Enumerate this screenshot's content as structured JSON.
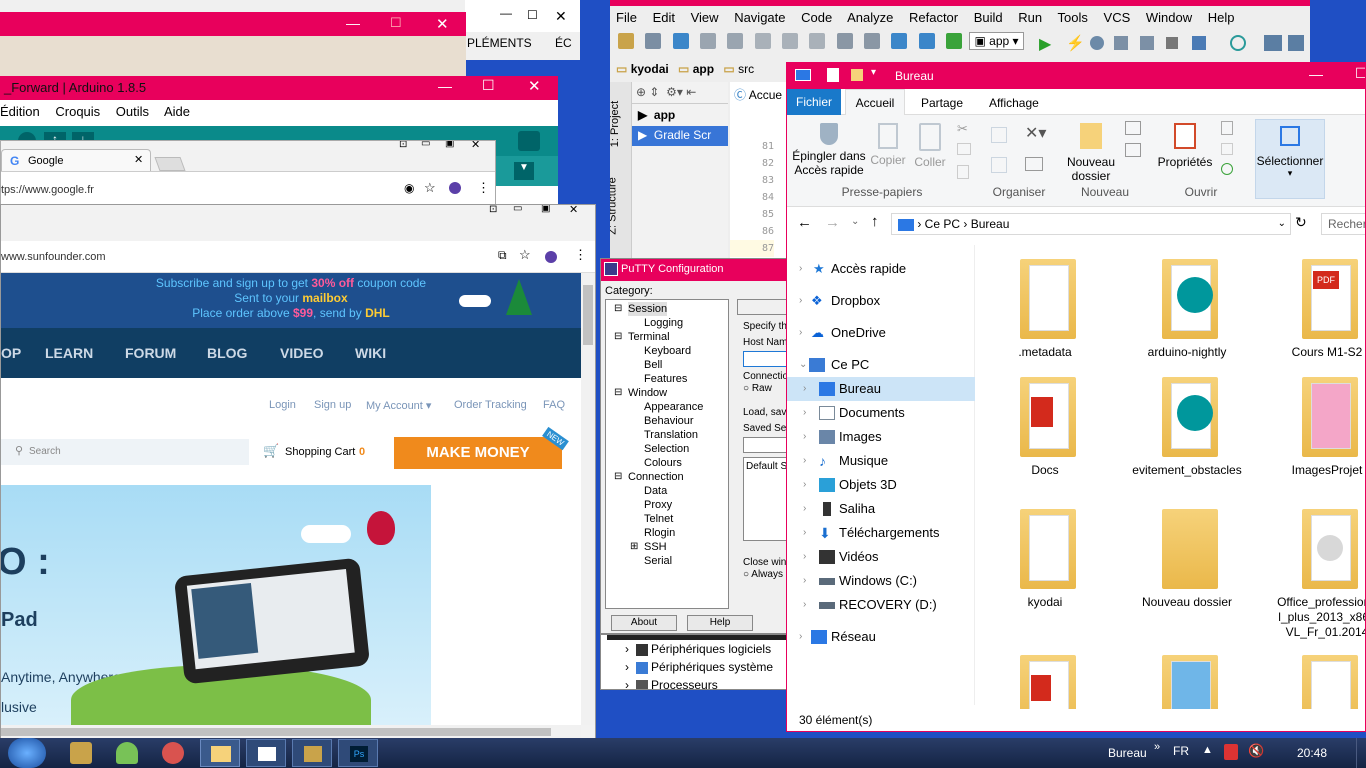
{
  "behind_window": {
    "tab1": "PLÉMENTS",
    "tab2": "ÉC"
  },
  "arduino_top": {},
  "arduino": {
    "title": "_Forward | Arduino 1.8.5",
    "menu": [
      "Édition",
      "Croquis",
      "Outils",
      "Aide"
    ]
  },
  "chrome_google": {
    "tab": "Google",
    "url": "tps://www.google.fr"
  },
  "sunfounder": {
    "url": "www.sunfounder.com",
    "banner_line1_a": "Subscribe and sign up to get ",
    "banner_line1_b": "30% off",
    "banner_line1_c": " coupon code",
    "banner_line2_a": "Sent to your ",
    "banner_line2_b": "mailbox",
    "banner_line3_a": "Place order above ",
    "banner_line3_b": "$99",
    "banner_line3_c": ",   send by ",
    "banner_line3_d": "DHL",
    "nav": [
      "OP",
      "LEARN",
      "FORUM",
      "BLOG",
      "VIDEO",
      "WIKI"
    ],
    "toplinks": [
      "Login",
      "Sign up",
      "My Account ▾",
      "Order Tracking",
      "FAQ"
    ],
    "search_placeholder": "Search",
    "cart_label": "Shopping Cart",
    "cart_count": "0",
    "make_money": "MAKE MONEY",
    "new_badge": "NEW",
    "hero_big": "O :",
    "hero_pad": "Pad",
    "hero_line1": "Anytime, Anywhere.",
    "hero_line2": "lusive"
  },
  "android_studio": {
    "menu": [
      "File",
      "Edit",
      "View",
      "Navigate",
      "Code",
      "Analyze",
      "Refactor",
      "Build",
      "Run",
      "Tools",
      "VCS",
      "Window",
      "Help"
    ],
    "run_config": "app",
    "breadcrumbs": [
      "kyodai",
      "app",
      "src"
    ],
    "side_tabs": [
      "1: Project",
      "Z: Structure"
    ],
    "tree": [
      "app",
      "Gradle Scr"
    ],
    "code_tab": "Accue",
    "line_numbers": [
      "81",
      "82",
      "83",
      "84",
      "85",
      "86",
      "87"
    ]
  },
  "putty": {
    "title": "PuTTY Configuration",
    "category_label": "Category:",
    "tree": [
      {
        "label": "Session",
        "level": 0,
        "toggle": "−"
      },
      {
        "label": "Logging",
        "level": 1,
        "toggle": ""
      },
      {
        "label": "Terminal",
        "level": 0,
        "toggle": "−"
      },
      {
        "label": "Keyboard",
        "level": 1,
        "toggle": ""
      },
      {
        "label": "Bell",
        "level": 1,
        "toggle": ""
      },
      {
        "label": "Features",
        "level": 1,
        "toggle": ""
      },
      {
        "label": "Window",
        "level": 0,
        "toggle": "−"
      },
      {
        "label": "Appearance",
        "level": 1,
        "toggle": ""
      },
      {
        "label": "Behaviour",
        "level": 1,
        "toggle": ""
      },
      {
        "label": "Translation",
        "level": 1,
        "toggle": ""
      },
      {
        "label": "Selection",
        "level": 1,
        "toggle": ""
      },
      {
        "label": "Colours",
        "level": 1,
        "toggle": ""
      },
      {
        "label": "Connection",
        "level": 0,
        "toggle": "−"
      },
      {
        "label": "Data",
        "level": 1,
        "toggle": ""
      },
      {
        "label": "Proxy",
        "level": 1,
        "toggle": ""
      },
      {
        "label": "Telnet",
        "level": 1,
        "toggle": ""
      },
      {
        "label": "Rlogin",
        "level": 1,
        "toggle": ""
      },
      {
        "label": "SSH",
        "level": 1,
        "toggle": "+"
      },
      {
        "label": "Serial",
        "level": 1,
        "toggle": ""
      }
    ],
    "specify": "Specify the",
    "host_name": "Host Name",
    "connection": "Connection",
    "raw": "Raw",
    "load_save": "Load, save",
    "saved_sessions": "Saved Ses",
    "default_settings": "Default Se",
    "close_window": "Close wind",
    "always": "Always",
    "about": "About",
    "help": "Help",
    "top_btn": "E"
  },
  "device_manager": {
    "items": [
      "Périphériques logiciels",
      "Périphériques système",
      "Processeurs"
    ]
  },
  "explorer": {
    "title": "Bureau",
    "ribbon_tabs": [
      "Fichier",
      "Accueil",
      "Partage",
      "Affichage"
    ],
    "groups": {
      "presse": "Presse-papiers",
      "organiser": "Organiser",
      "nouveau": "Nouveau",
      "ouvrir": "Ouvrir"
    },
    "buttons": {
      "epingler": "Épingler dans Accès rapide",
      "copier": "Copier",
      "coller": "Coller",
      "nouveau_dossier": "Nouveau dossier",
      "proprietes": "Propriétés",
      "selectionner": "Sélectionner"
    },
    "address": [
      "Ce PC",
      "Bureau"
    ],
    "search_placeholder": "Recher",
    "nav": [
      {
        "label": "Accès rapide",
        "icon": "star-icon",
        "color": "#1e78d6",
        "indent": 0
      },
      {
        "label": "Dropbox",
        "icon": "dropbox-icon",
        "color": "#0a62d6",
        "indent": 0
      },
      {
        "label": "OneDrive",
        "icon": "cloud-icon",
        "color": "#0a62d6",
        "indent": 0
      },
      {
        "label": "Ce PC",
        "icon": "computer-icon",
        "color": "#3a7bd5",
        "indent": 0
      },
      {
        "label": "Bureau",
        "icon": "desktop-icon",
        "color": "#2b78e4",
        "indent": 1
      },
      {
        "label": "Documents",
        "icon": "document-icon",
        "color": "#7a8a99",
        "indent": 1
      },
      {
        "label": "Images",
        "icon": "image-icon",
        "color": "#6a86a8",
        "indent": 1
      },
      {
        "label": "Musique",
        "icon": "music-icon",
        "color": "#1a6fd0",
        "indent": 1
      },
      {
        "label": "Objets 3D",
        "icon": "cube-icon",
        "color": "#2aa0d8",
        "indent": 1
      },
      {
        "label": "Saliha",
        "icon": "phone-icon",
        "color": "#333333",
        "indent": 1
      },
      {
        "label": "Téléchargements",
        "icon": "download-icon",
        "color": "#1a6fd0",
        "indent": 1
      },
      {
        "label": "Vidéos",
        "icon": "video-icon",
        "color": "#333333",
        "indent": 1
      },
      {
        "label": "Windows (C:)",
        "icon": "drive-icon",
        "color": "#5a6a7a",
        "indent": 1
      },
      {
        "label": "RECOVERY (D:)",
        "icon": "drive-icon",
        "color": "#5a6a7a",
        "indent": 1
      },
      {
        "label": "Réseau",
        "icon": "network-icon",
        "color": "#2b78e4",
        "indent": 0
      }
    ],
    "items": [
      {
        "label": ".metadata",
        "kind": "folder"
      },
      {
        "label": "arduino-nightly",
        "kind": "arduino"
      },
      {
        "label": "Cours M1-S2",
        "kind": "pdf"
      },
      {
        "label": "Docs",
        "kind": "pdf"
      },
      {
        "label": "evitement_obstacles",
        "kind": "arduino"
      },
      {
        "label": "ImagesProjet",
        "kind": "folder"
      },
      {
        "label": "kyodai",
        "kind": "folder"
      },
      {
        "label": "Nouveau dossier",
        "kind": "folder"
      },
      {
        "label": "Office_professional_plus_2013_x86_VL_Fr_01.2014",
        "kind": "disc"
      },
      {
        "label": "",
        "kind": "pdf"
      },
      {
        "label": "",
        "kind": "folder"
      },
      {
        "label": "",
        "kind": "folder"
      }
    ],
    "status": "30 élément(s)"
  },
  "taskbar": {
    "location": "Bureau",
    "lang": "FR",
    "time": "20:48"
  }
}
